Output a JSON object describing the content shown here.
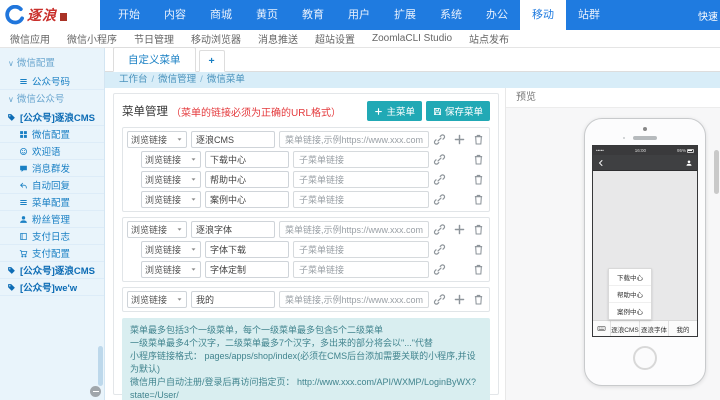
{
  "topbar": {
    "logo_text": "逐浪",
    "items": [
      "开始",
      "内容",
      "商城",
      "黄页",
      "教育",
      "用户",
      "扩展",
      "系统",
      "办公",
      "移动",
      "站群"
    ],
    "active": "移动",
    "right_link": "快速"
  },
  "subnav": {
    "items": [
      "微信应用",
      "微信小程序",
      "节日管理",
      "移动浏览器",
      "消息推送",
      "超站设置",
      "ZoomlaCLI Studio",
      "站点发布"
    ]
  },
  "sidebar": {
    "groups": [
      {
        "label": "微信配置",
        "items": [
          {
            "icon": "list",
            "label": "公众号码",
            "style": "item"
          }
        ]
      },
      {
        "label": "微信公众号",
        "items": [
          {
            "icon": "tag",
            "label": "[公众号]逐浪CMS",
            "style": "strong"
          },
          {
            "icon": "grid",
            "label": "微信配置",
            "style": "item"
          },
          {
            "icon": "smile",
            "label": "欢迎语",
            "style": "item"
          },
          {
            "icon": "chat",
            "label": "消息群发",
            "style": "item"
          },
          {
            "icon": "reply",
            "label": "自动回复",
            "style": "item"
          },
          {
            "icon": "list",
            "label": "菜单配置",
            "style": "item"
          },
          {
            "icon": "user",
            "label": "粉丝管理",
            "style": "item"
          },
          {
            "icon": "book",
            "label": "支付日志",
            "style": "item"
          },
          {
            "icon": "cart",
            "label": "支付配置",
            "style": "item"
          },
          {
            "icon": "tag",
            "label": "[公众号]逐浪CMS",
            "style": "strong"
          },
          {
            "icon": "tag",
            "label": "[公众号]we'w",
            "style": "strong"
          }
        ]
      }
    ]
  },
  "tabs": {
    "active": "自定义菜单",
    "add": "+"
  },
  "breadcrumb": {
    "parts": [
      "工作台",
      "微信管理",
      "微信菜单"
    ]
  },
  "editor": {
    "title": "菜单管理",
    "title_note": "（菜单的链接必须为正确的URL格式）",
    "buttons": {
      "add_main": "主菜单",
      "save": "保存菜单"
    },
    "select_label": "浏览链接",
    "main_placeholder": "菜单链接,示例https://www.xxx.com/",
    "sub_placeholder": "子菜单链接",
    "groups": [
      {
        "name": "逐浪CMS",
        "children": [
          "下载中心",
          "帮助中心",
          "案例中心"
        ]
      },
      {
        "name": "逐浪字体",
        "children": [
          "字体下载",
          "字体定制"
        ]
      },
      {
        "name": "我的",
        "children": []
      }
    ],
    "tips": [
      "菜单最多包括3个一级菜单，每个一级菜单最多包含5个二级菜单",
      "一级菜单最多4个汉字，二级菜单最多7个汉字，多出来的部分将会以\"...\"代替",
      "小程序链接格式： pages/apps/shop/index(必须在CMS后台添加需要关联的小程序,并设为默认)",
      "微信用户自动注册/登录后再访问指定页： http://www.xxx.com/API/WXMP/LoginByWX?state=/User/"
    ]
  },
  "preview": {
    "title": "预览",
    "phone": {
      "carrier": "•••••",
      "time": "16:00",
      "battery": "95%",
      "menu": [
        "逐浪CMS",
        "逐浪字体",
        "我的"
      ],
      "popup": [
        "下载中心",
        "帮助中心",
        "案例中心"
      ]
    }
  },
  "colors": {
    "topbar_blue": "#1f7be0",
    "link_blue": "#1a80c4",
    "button_teal": "#21a9b5",
    "note_red": "#e4393c",
    "tip_bg": "#d9eef0",
    "crumb_bg": "#d8edf8",
    "sidebar_bg": "#e9f4fb"
  }
}
